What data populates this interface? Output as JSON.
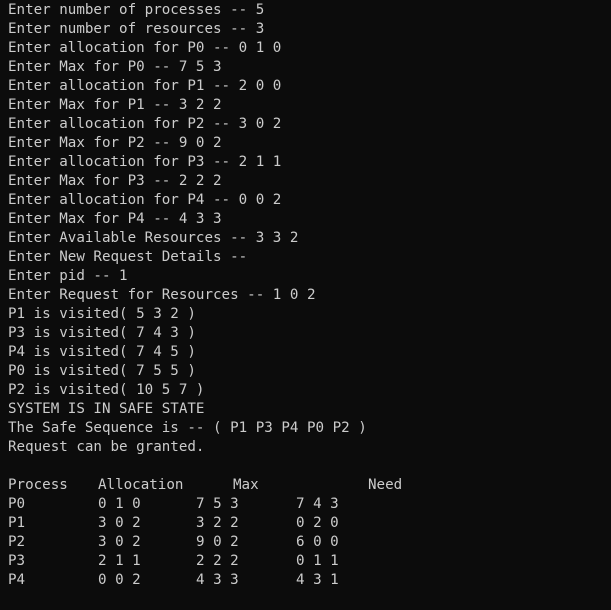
{
  "terminal": {
    "foreground": "#cccccc",
    "background": "#0c0c0c",
    "lines": [
      "Enter number of processes -- 5",
      "Enter number of resources -- 3",
      "Enter allocation for P0 -- 0 1 0",
      "Enter Max for P0 -- 7 5 3",
      "Enter allocation for P1 -- 2 0 0",
      "Enter Max for P1 -- 3 2 2",
      "Enter allocation for P2 -- 3 0 2",
      "Enter Max for P2 -- 9 0 2",
      "Enter allocation for P3 -- 2 1 1",
      "Enter Max for P3 -- 2 2 2",
      "Enter allocation for P4 -- 0 0 2",
      "Enter Max for P4 -- 4 3 3",
      "Enter Available Resources -- 3 3 2",
      "Enter New Request Details --",
      "Enter pid -- 1",
      "Enter Request for Resources -- 1 0 2",
      "P1 is visited( 5 3 2 )",
      "P3 is visited( 7 4 3 )",
      "P4 is visited( 7 4 5 )",
      "P0 is visited( 7 5 5 )",
      "P2 is visited( 10 5 7 )",
      "SYSTEM IS IN SAFE STATE",
      "The Safe Sequence is -- ( P1 P3 P4 P0 P2 )",
      "Request can be granted."
    ],
    "table": {
      "headers": [
        "Process",
        "Allocation",
        "Max",
        "Need"
      ],
      "rows": [
        [
          "P0",
          "0 1 0",
          "7 5 3",
          "7 4 3"
        ],
        [
          "P1",
          "3 0 2",
          "3 2 2",
          "0 2 0"
        ],
        [
          "P2",
          "3 0 2",
          "9 0 2",
          "6 0 0"
        ],
        [
          "P3",
          "2 1 1",
          "2 2 2",
          "0 1 1"
        ],
        [
          "P4",
          "0 0 2",
          "4 3 3",
          "4 3 1"
        ]
      ]
    }
  }
}
